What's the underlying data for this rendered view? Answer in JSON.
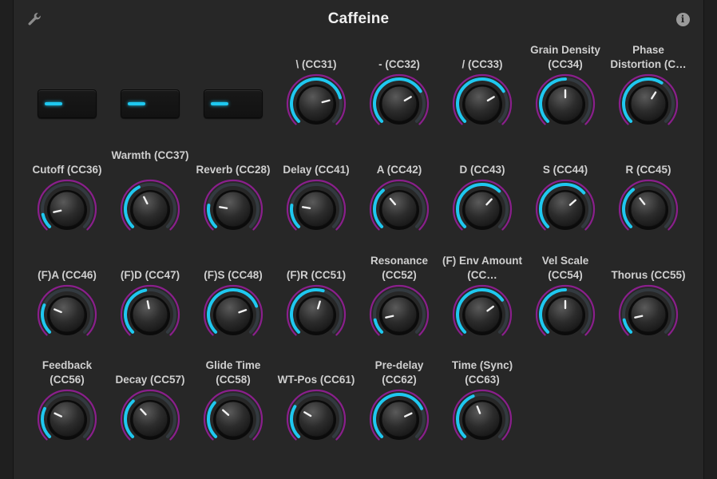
{
  "app": {
    "title": "Caffeine"
  },
  "header": {
    "left_icon": "wrench-icon",
    "right_icon": "info-icon",
    "info_glyph": "i"
  },
  "colors": {
    "accent": "#1ec8f0",
    "ring": "#8a1f8c",
    "background": "#272727"
  },
  "buttons": [
    {
      "name": "toggle-button-1",
      "led": "on"
    },
    {
      "name": "toggle-button-2",
      "led": "on"
    },
    {
      "name": "toggle-button-3",
      "led": "on"
    }
  ],
  "knobs": [
    {
      "label": "\\ (CC31)",
      "value": 0.78
    },
    {
      "label": "- (CC32)",
      "value": 0.72
    },
    {
      "label": "/ (CC33)",
      "value": 0.72
    },
    {
      "label": "Grain Density (CC34)",
      "value": 0.5
    },
    {
      "label": "Phase Distortion (C…",
      "value": 0.62
    },
    {
      "label": "Cutoff (CC36)",
      "value": 0.12
    },
    {
      "label": "Warmth (CC37)",
      "value": 0.4
    },
    {
      "label": "Reverb (CC28)",
      "value": 0.2
    },
    {
      "label": "Delay (CC41)",
      "value": 0.2
    },
    {
      "label": "A (CC42)",
      "value": 0.35
    },
    {
      "label": "D (CC43)",
      "value": 0.66
    },
    {
      "label": "S (CC44)",
      "value": 0.68
    },
    {
      "label": "R (CC45)",
      "value": 0.36
    },
    {
      "label": "(F)A (CC46)",
      "value": 0.25
    },
    {
      "label": "(F)D (CC47)",
      "value": 0.46
    },
    {
      "label": "(F)S (CC48)",
      "value": 0.76
    },
    {
      "label": "(F)R (CC51)",
      "value": 0.56
    },
    {
      "label": "Resonance (CC52)",
      "value": 0.12
    },
    {
      "label": "(F) Env Amount (CC…",
      "value": 0.7
    },
    {
      "label": "Vel Scale (CC54)",
      "value": 0.5
    },
    {
      "label": "Thorus (CC55)",
      "value": 0.12
    },
    {
      "label": "Feedback (CC56)",
      "value": 0.26
    },
    {
      "label": "Decay (CC57)",
      "value": 0.34
    },
    {
      "label": "Glide Time (CC58)",
      "value": 0.32
    },
    {
      "label": "WT-Pos (CC61)",
      "value": 0.28
    },
    {
      "label": "Pre-delay (CC62)",
      "value": 0.74
    },
    {
      "label": "Time (Sync) (CC63)",
      "value": 0.42
    }
  ]
}
